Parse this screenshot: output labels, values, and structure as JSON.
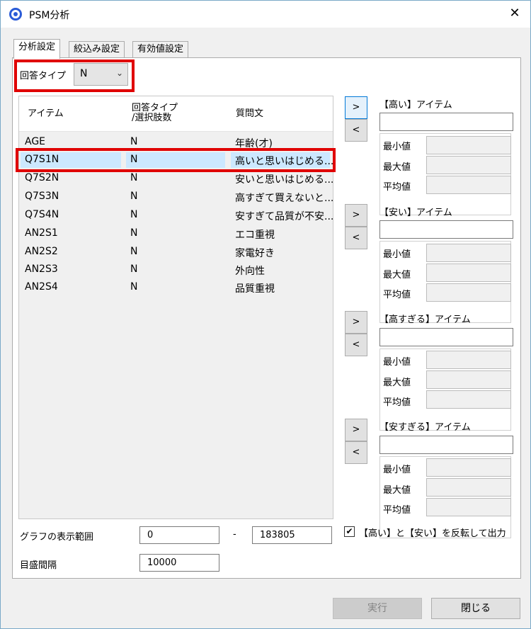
{
  "window": {
    "title": "PSM分析",
    "close_glyph": "✕"
  },
  "tabs": [
    {
      "label": "分析設定",
      "active": true
    },
    {
      "label": "絞込み設定",
      "active": false
    },
    {
      "label": "有効値設定",
      "active": false
    }
  ],
  "answer_type": {
    "label": "回答タイプ",
    "value": "N",
    "chevron": "⌄"
  },
  "list": {
    "headers": {
      "item": "アイテム",
      "type_line1": "回答タイプ",
      "type_line2": "/選択肢数",
      "question": "質問文"
    },
    "rows": [
      {
        "item": "AGE",
        "type": "N",
        "question": "年齢(才)",
        "selected": false
      },
      {
        "item": "Q7S1N",
        "type": "N",
        "question": "高いと思いはじめる...",
        "selected": true
      },
      {
        "item": "Q7S2N",
        "type": "N",
        "question": "安いと思いはじめる...",
        "selected": false
      },
      {
        "item": "Q7S3N",
        "type": "N",
        "question": "高すぎて買えないと...",
        "selected": false
      },
      {
        "item": "Q7S4N",
        "type": "N",
        "question": "安すぎて品質が不安...",
        "selected": false
      },
      {
        "item": "AN2S1",
        "type": "N",
        "question": "エコ重視",
        "selected": false
      },
      {
        "item": "AN2S2",
        "type": "N",
        "question": "家電好き",
        "selected": false
      },
      {
        "item": "AN2S3",
        "type": "N",
        "question": "外向性",
        "selected": false
      },
      {
        "item": "AN2S4",
        "type": "N",
        "question": "品質重視",
        "selected": false
      }
    ]
  },
  "groups": [
    {
      "title": "【高い】アイテム",
      "add": ">",
      "remove": "<",
      "min": "最小値",
      "max": "最大値",
      "avg": "平均値"
    },
    {
      "title": "【安い】アイテム",
      "add": ">",
      "remove": "<",
      "min": "最小値",
      "max": "最大値",
      "avg": "平均値"
    },
    {
      "title": "【高すぎる】アイテム",
      "add": ">",
      "remove": "<",
      "min": "最小値",
      "max": "最大値",
      "avg": "平均値"
    },
    {
      "title": "【安すぎる】アイテム",
      "add": ">",
      "remove": "<",
      "min": "最小値",
      "max": "最大値",
      "avg": "平均値"
    }
  ],
  "range": {
    "label": "グラフの表示範囲",
    "min": "0",
    "separator": "-",
    "max": "183805"
  },
  "tick": {
    "label": "目盛間隔",
    "value": "10000"
  },
  "invert": {
    "checked": true,
    "check_glyph": "✔",
    "label": "【高い】と【安い】を反転して出力"
  },
  "buttons": {
    "run": "実行",
    "close": "閉じる"
  },
  "colors": {
    "highlight": "#cce8ff",
    "red_frame": "#e00000",
    "accent": "#0078d7"
  }
}
